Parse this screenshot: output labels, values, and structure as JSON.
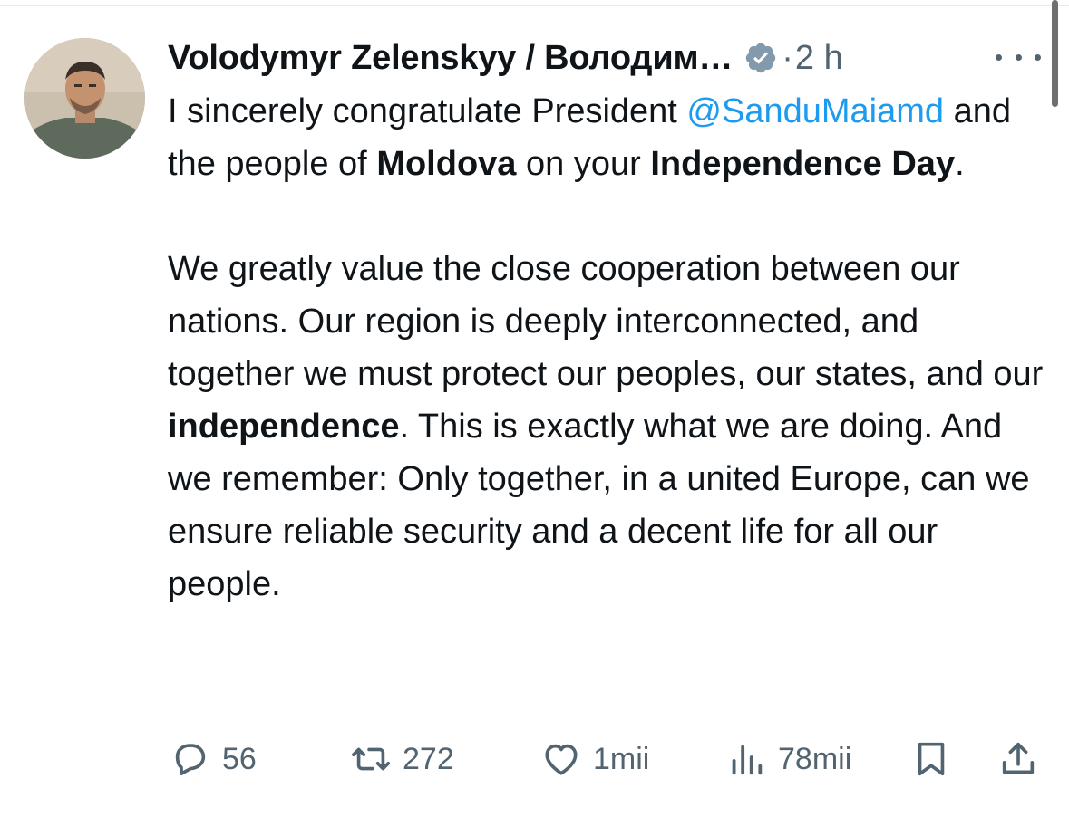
{
  "tweet": {
    "author_name": "Volodymyr Zelenskyy / Володим…",
    "separator": "·",
    "time": "2 h",
    "body": {
      "p1_a": "I sincerely congratulate President ",
      "p1_mention": "@SanduMaiamd",
      "p1_b": " and the people of ",
      "p1_bold1": "Moldova",
      "p1_c": " on your ",
      "p1_bold2": "Independence Day",
      "p1_d": ".",
      "p2_a": "We greatly value the close cooperation between our nations. Our region is deeply interconnected, and together we must protect our peoples, our states, and our ",
      "p2_bold": "independence",
      "p2_b": ". This is exactly what we are doing. And we remember: Only together, in a united Europe, can we ensure reliable security and a decent life for all our people."
    },
    "actions": {
      "replies": "56",
      "reposts": "272",
      "likes": "1mii",
      "views": "78mii"
    }
  },
  "icons": {
    "verified": "verified-badge-icon",
    "more": "more-dots-icon",
    "reply": "reply-icon",
    "repost": "repost-icon",
    "like": "heart-icon",
    "views": "views-icon",
    "bookmark": "bookmark-icon",
    "share": "share-icon"
  },
  "colors": {
    "text": "#0f1419",
    "secondary": "#536471",
    "link": "#1d9bf0",
    "verified_badge": "#829aab"
  }
}
